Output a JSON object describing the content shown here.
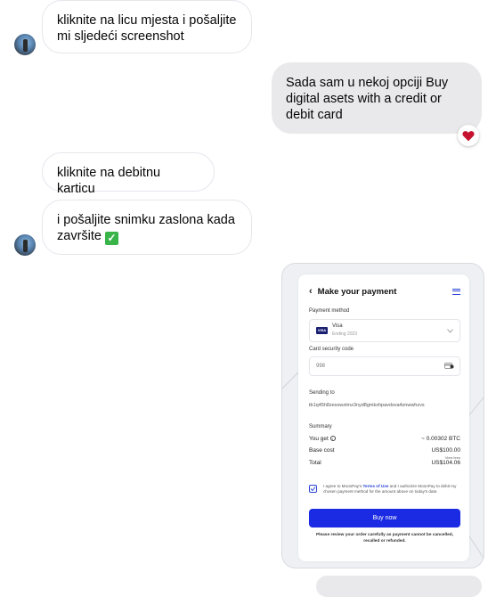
{
  "messages": [
    {
      "id": "m1",
      "text": "kliknite na licu mjesta i pošaljite mi sljedeći screenshot"
    },
    {
      "id": "m2",
      "text": "Sada sam u nekoj opciji Buy digital asets with a credit or debit card"
    },
    {
      "id": "m3",
      "text": "kliknite na debitnu karticu"
    },
    {
      "id": "m4",
      "text": "i pošaljite snimku zaslona kada završite"
    }
  ],
  "check_emoji": "✓",
  "reaction": "heart",
  "screenshot": {
    "title": "Make your payment",
    "payment_method_label": "Payment method",
    "card_name": "Visa",
    "card_ending": "Ending 2023",
    "card_badge": "VISA",
    "security_label": "Card security code",
    "security_value": "998",
    "sending_label": "Sending to",
    "address": "tb1q45h8zesxwztmz3nyd8gmkxhpavdsva4znwwhzvs",
    "summary_label": "Summary",
    "you_get_label": "You get",
    "you_get_value": "~ 0.00302 BTC",
    "base_cost_label": "Base cost",
    "base_cost_value": "US$100.00",
    "view_fees": "View fees",
    "total_label": "Total",
    "total_value": "US$104.06",
    "agree_prefix": "I agree to MoonPay's ",
    "terms": "Terms of Use",
    "agree_suffix": " and I authorize MoonPay to debit my chosen payment method for the amount above on today's date.",
    "buy_button": "Buy now",
    "disclaimer": "Please review your order carefully as payment cannot be cancelled, recalled or refunded."
  },
  "colors": {
    "accent": "#2d46d6",
    "button": "#1a2be3",
    "heart": "#e0245e"
  }
}
